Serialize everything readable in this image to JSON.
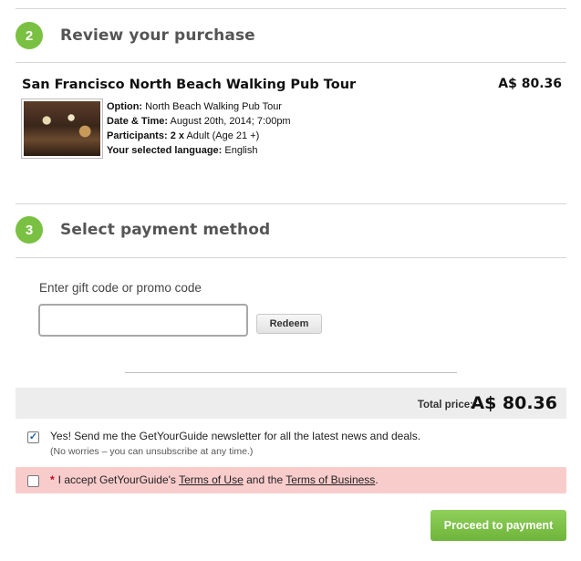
{
  "review": {
    "step_number": "2",
    "title": "Review your purchase",
    "tour_title": "San Francisco North Beach Walking Pub Tour",
    "price": "A$ 80.36",
    "thumbnail_icon": "tour-photo",
    "details": [
      {
        "label": "Option:",
        "value": "North Beach Walking Pub Tour"
      },
      {
        "label": "Date & Time:",
        "value": "August 20th, 2014; 7:00pm"
      },
      {
        "label": "Participants:",
        "value": "2 x",
        "extra": "Adult (Age 21 +)"
      },
      {
        "label": "Your selected language:",
        "value": "English"
      }
    ]
  },
  "payment": {
    "step_number": "3",
    "title": "Select payment method",
    "promo_label": "Enter gift code or promo code",
    "promo_value": "",
    "promo_placeholder": "",
    "redeem_label": "Redeem"
  },
  "total": {
    "label": "Total price:",
    "value": "A$ 80.36"
  },
  "newsletter": {
    "checked": true,
    "text": "Yes! Send me the GetYourGuide newsletter for all the latest news and deals.",
    "subtext": "(No worries – you can unsubscribe at any time.)"
  },
  "terms": {
    "checked": false,
    "required_mark": "*",
    "prefix": "I accept GetYourGuide's",
    "terms_of_use": "Terms of Use",
    "middle": "and the",
    "terms_of_business": "Terms of Business",
    "suffix": "."
  },
  "proceed_label": "Proceed to payment",
  "colors": {
    "accent_green": "#7ac143",
    "terms_bg": "#f9cccc",
    "total_bg": "#ededed"
  }
}
